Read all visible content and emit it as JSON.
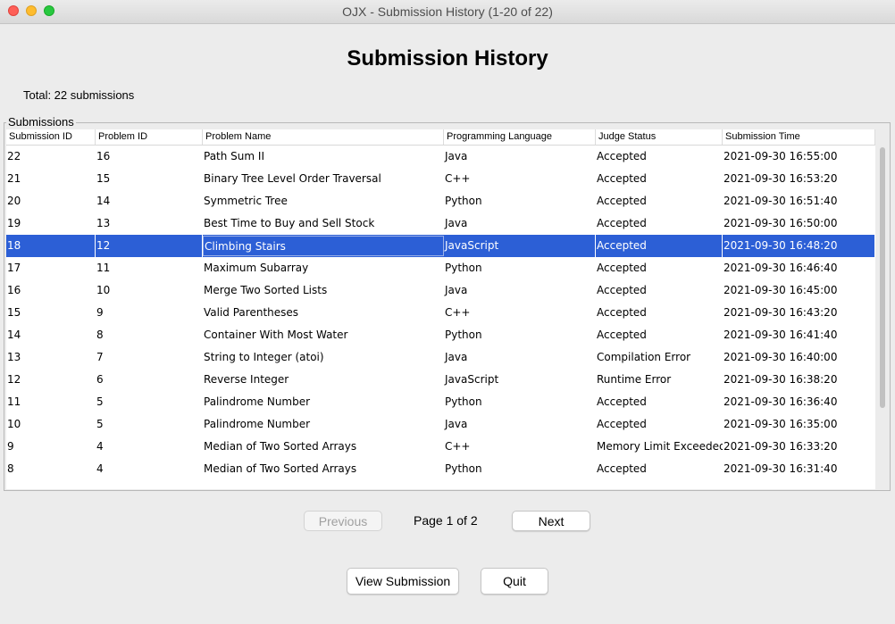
{
  "window": {
    "title": "OJX - Submission History (1-20 of 22)"
  },
  "header": {
    "title": "Submission History",
    "total": "Total: 22 submissions"
  },
  "group": {
    "label": "Submissions"
  },
  "table": {
    "columns": [
      "Submission ID",
      "Problem ID",
      "Problem Name",
      "Programming Language",
      "Judge Status",
      "Submission Time"
    ],
    "selected_index": 4,
    "rows": [
      [
        "22",
        "16",
        "Path Sum II",
        "Java",
        "Accepted",
        "2021-09-30 16:55:00"
      ],
      [
        "21",
        "15",
        "Binary Tree Level Order Traversal",
        "C++",
        "Accepted",
        "2021-09-30 16:53:20"
      ],
      [
        "20",
        "14",
        "Symmetric Tree",
        "Python",
        "Accepted",
        "2021-09-30 16:51:40"
      ],
      [
        "19",
        "13",
        "Best Time to Buy and Sell Stock",
        "Java",
        "Accepted",
        "2021-09-30 16:50:00"
      ],
      [
        "18",
        "12",
        "Climbing Stairs",
        "JavaScript",
        "Accepted",
        "2021-09-30 16:48:20"
      ],
      [
        "17",
        "11",
        "Maximum Subarray",
        "Python",
        "Accepted",
        "2021-09-30 16:46:40"
      ],
      [
        "16",
        "10",
        "Merge Two Sorted Lists",
        "Java",
        "Accepted",
        "2021-09-30 16:45:00"
      ],
      [
        "15",
        "9",
        "Valid Parentheses",
        "C++",
        "Accepted",
        "2021-09-30 16:43:20"
      ],
      [
        "14",
        "8",
        "Container With Most Water",
        "Python",
        "Accepted",
        "2021-09-30 16:41:40"
      ],
      [
        "13",
        "7",
        "String to Integer (atoi)",
        "Java",
        "Compilation Error",
        "2021-09-30 16:40:00"
      ],
      [
        "12",
        "6",
        "Reverse Integer",
        "JavaScript",
        "Runtime Error",
        "2021-09-30 16:38:20"
      ],
      [
        "11",
        "5",
        "Palindrome Number",
        "Python",
        "Accepted",
        "2021-09-30 16:36:40"
      ],
      [
        "10",
        "5",
        "Palindrome Number",
        "Java",
        "Accepted",
        "2021-09-30 16:35:00"
      ],
      [
        "9",
        "4",
        "Median of Two Sorted Arrays",
        "C++",
        "Memory Limit Exceeded",
        "2021-09-30 16:33:20"
      ],
      [
        "8",
        "4",
        "Median of Two Sorted Arrays",
        "Python",
        "Accepted",
        "2021-09-30 16:31:40"
      ]
    ]
  },
  "pager": {
    "previous": "Previous",
    "page": "Page 1 of 2",
    "next": "Next"
  },
  "actions": {
    "view": "View Submission",
    "quit": "Quit"
  },
  "colors": {
    "selection": "#2c5fd6",
    "close": "#fe5f57",
    "minimize": "#febc2e",
    "maximize": "#28c840"
  }
}
